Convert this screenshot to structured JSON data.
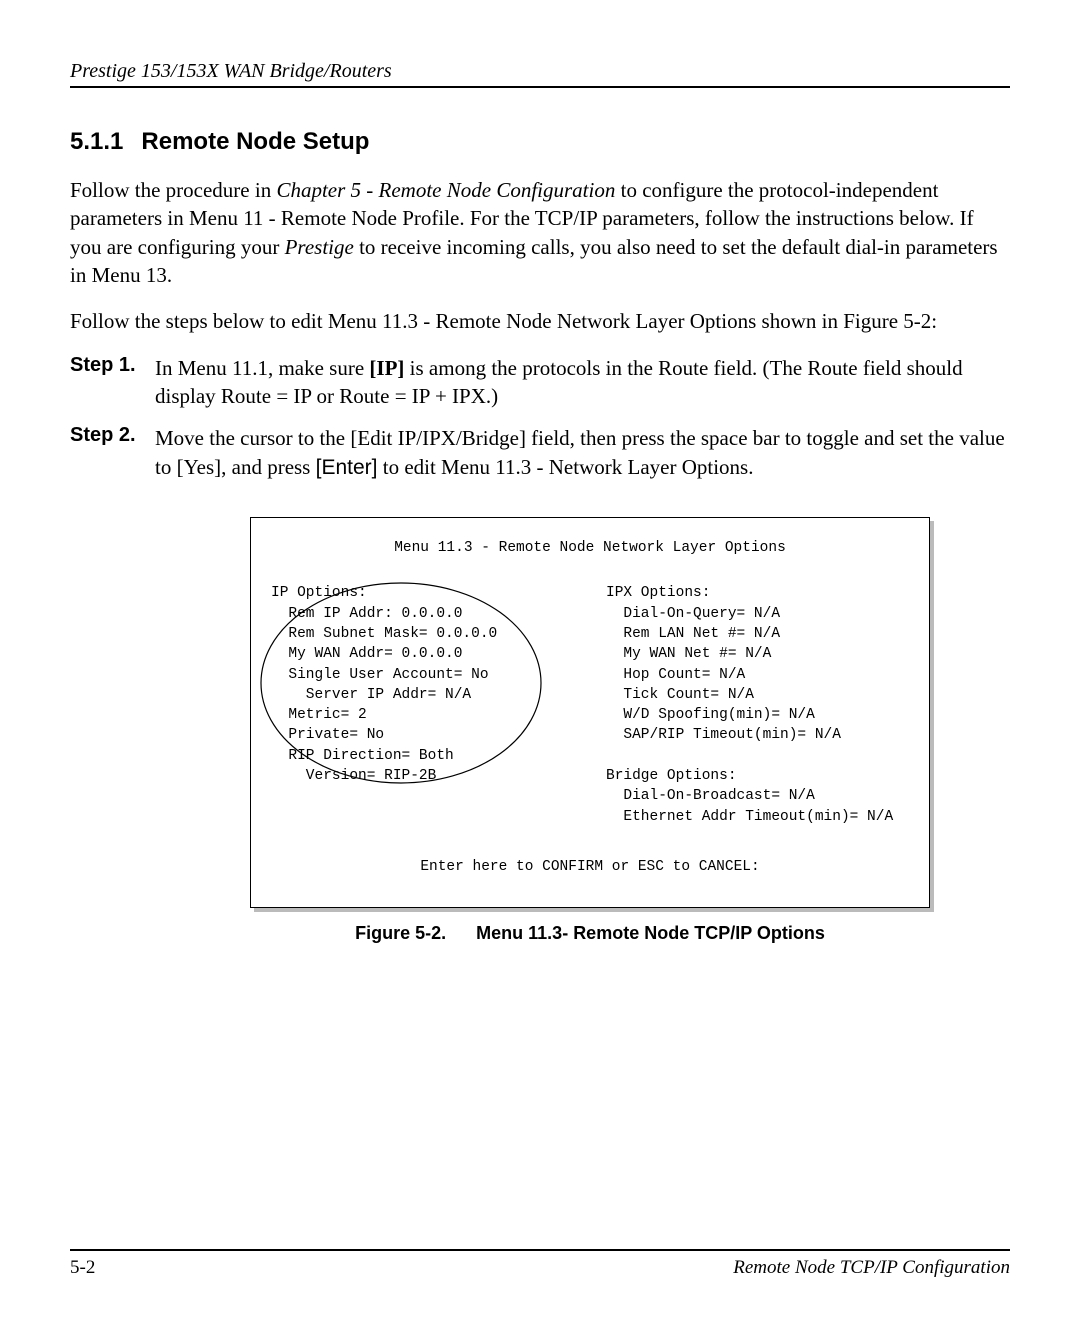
{
  "header": {
    "title": "Prestige 153/153X  WAN Bridge/Routers"
  },
  "section": {
    "number": "5.1.1",
    "title": "Remote Node Setup"
  },
  "paragraphs": {
    "p1_part1": "Follow the procedure in ",
    "p1_italic": "Chapter 5 - Remote Node Configuration",
    "p1_part2": " to configure the protocol-independent parameters in Menu 11 - Remote Node Profile.  For the TCP/IP parameters, follow the instructions below.  If you are configuring your ",
    "p1_italic2": "Prestige",
    "p1_part3": " to receive incoming calls, you also need to set the default dial-in parameters in Menu 13.",
    "p2": "Follow the steps below to edit Menu 11.3 - Remote Node Network Layer Options shown in Figure 5-2:"
  },
  "steps": [
    {
      "label": "Step 1.",
      "text_a": "In Menu 11.1, make sure ",
      "bold": "[IP]",
      "text_b": " is among the protocols in the Route field. (The Route field should display Route = IP or Route = IP + IPX.)"
    },
    {
      "label": "Step 2.",
      "text_a": "Move the cursor to the [Edit IP/IPX/Bridge] field, then press the space bar to toggle and set the value to [Yes], and press ",
      "key": "[Enter]",
      "text_b": " to edit Menu 11.3 - Network Layer Options."
    }
  ],
  "menu": {
    "title": "Menu 11.3 - Remote Node Network Layer Options",
    "left": "IP Options:\n  Rem IP Addr: 0.0.0.0\n  Rem Subnet Mask= 0.0.0.0\n  My WAN Addr= 0.0.0.0\n  Single User Account= No\n    Server IP Addr= N/A\n  Metric= 2\n  Private= No\n  RIP Direction= Both\n    Version= RIP-2B",
    "right": "IPX Options:\n  Dial-On-Query= N/A\n  Rem LAN Net #= N/A\n  My WAN Net #= N/A\n  Hop Count= N/A\n  Tick Count= N/A\n  W/D Spoofing(min)= N/A\n  SAP/RIP Timeout(min)= N/A\n\nBridge Options:\n  Dial-On-Broadcast= N/A\n  Ethernet Addr Timeout(min)= N/A",
    "footer": "Enter here to CONFIRM or ESC to CANCEL:"
  },
  "figure_caption": {
    "number": "Figure 5-2.",
    "text": "Menu 11.3- Remote Node TCP/IP Options"
  },
  "footer": {
    "page": "5-2",
    "chapter": "Remote Node TCP/IP Configuration"
  }
}
